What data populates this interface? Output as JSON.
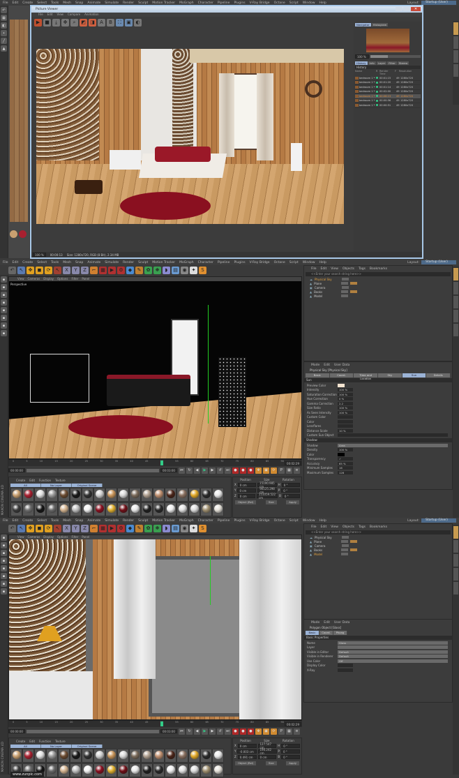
{
  "menu": [
    "File",
    "Edit",
    "Create",
    "Select",
    "Tools",
    "Mesh",
    "Snap",
    "Animate",
    "Simulate",
    "Render",
    "Sculpt",
    "Motion Tracker",
    "MoGraph",
    "Character",
    "Pipeline",
    "Plugins",
    "V-Ray Bridge",
    "Octane",
    "Script",
    "Window",
    "Help"
  ],
  "layout_label": "Layout:",
  "layout_value": "Startup (User)",
  "picture_viewer": {
    "title": "Picture Viewer",
    "menu": [
      "File",
      "Edit",
      "View",
      "Compare",
      "Animation"
    ],
    "side_tabs": [
      "Navigator",
      "Histogram"
    ],
    "zoom": "100 %",
    "info_tabs": [
      "History",
      "Info",
      "Layer",
      "Filter",
      "Stereo"
    ],
    "history_label": "History",
    "columns": [
      "Name",
      "R",
      "Render Time",
      "F",
      "Resolution"
    ],
    "rows": [
      {
        "name": "bedroom 1 *",
        "time": "00:01:15",
        "frame": "49",
        "res": "1280x720"
      },
      {
        "name": "bedroom 1 *",
        "time": "00:01:20",
        "frame": "49",
        "res": "1280x720"
      },
      {
        "name": "bedroom 1 *",
        "time": "00:01:14",
        "frame": "49",
        "res": "1280x720"
      },
      {
        "name": "bedroom 1 *",
        "time": "00:02:00",
        "frame": "49",
        "res": "1280x720"
      },
      {
        "name": "bedroom 1 *",
        "time": "00:06:13",
        "frame": "49",
        "res": "1280x720",
        "selected": true
      },
      {
        "name": "bedroom 1 *",
        "time": "00:00:56",
        "frame": "49",
        "res": "1280x720"
      },
      {
        "name": "bedroom 1 *",
        "time": "00:00:51",
        "frame": "49",
        "res": "1280x720"
      }
    ],
    "status_zoom": "100 %",
    "status_time": "00:00:13",
    "status_size": "Size: 1280x720, RGB (8 Bit), 2.34 MB"
  },
  "panels": [
    {
      "viewport_menu": [
        "View",
        "Cameras",
        "Display",
        "Options",
        "Filter",
        "Panel"
      ],
      "viewport_label": "Perspective",
      "ticks": [
        "0",
        "5",
        "10",
        "15",
        "20",
        "25",
        "30",
        "35",
        "40",
        "45",
        "50",
        "55",
        "60",
        "65",
        "70",
        "75",
        "80",
        "85",
        "90"
      ],
      "frame_end": "00:02:29",
      "time_start": "00:00:00",
      "time_cur": "00:03:00",
      "mat_menu": [
        "Create",
        "Edit",
        "Function",
        "Texture"
      ],
      "mat_tabs": [
        "All",
        "No Layer",
        "Original Scene Textures"
      ],
      "coord_headers": [
        "Position",
        "Size",
        "Rotation"
      ],
      "coords": [
        [
          "X",
          "0 cm",
          "15190.985 cm",
          "H",
          "0 °"
        ],
        [
          "Y",
          "0 cm",
          "90125.298 cm",
          "P",
          "0 °"
        ],
        [
          "Z",
          "0 cm",
          "151059.522 cm",
          "B",
          "0 °"
        ]
      ],
      "coord_mode": "Object (Rel)",
      "coord_size": "Size",
      "apply": "Apply",
      "om_menu": [
        "File",
        "Edit",
        "View",
        "Objects",
        "Tags",
        "Bookmarks"
      ],
      "search_placeholder": "<<Enter your search string here>>",
      "objects": [
        "Physical Sky",
        "Plane",
        "Camera",
        "Books",
        "Model"
      ],
      "am_menu": [
        "Mode",
        "Edit",
        "User Data"
      ],
      "am_title": "Physical Sky [Physical Sky]",
      "am_tabs": [
        "Basic",
        "Coord.",
        "Time and Location",
        "Sky",
        "Sun",
        "Details"
      ],
      "am_active": 4,
      "section": "Sun",
      "props": [
        {
          "label": "Preview Color",
          "value": ""
        },
        {
          "label": "Intensity",
          "value": "100 %"
        },
        {
          "label": "Saturation Correction",
          "value": "100 %"
        },
        {
          "label": "Hue Correction",
          "value": "0 %"
        },
        {
          "label": "Gamma Correction",
          "value": "2.2"
        },
        {
          "label": "Size Ratio",
          "value": "100 %"
        },
        {
          "label": "As Seen Intensity",
          "value": "100 %"
        },
        {
          "label": "Custom Color",
          "value": ""
        },
        {
          "label": "Color",
          "value": ""
        },
        {
          "label": "Lensflares",
          "value": ""
        },
        {
          "label": "Distance Scale",
          "value": "10 %"
        },
        {
          "label": "Custom Sun Object",
          "value": ""
        }
      ],
      "section2": "Shadow",
      "props2": [
        {
          "label": "Shadow",
          "wide": "Area"
        },
        {
          "label": "Density",
          "value": "100 %"
        },
        {
          "label": "Color",
          "value": ""
        },
        {
          "label": "Transparency",
          "value": "✓"
        },
        {
          "label": "Accuracy",
          "value": "65 %"
        },
        {
          "label": "Minimum Samples",
          "value": "16"
        },
        {
          "label": "Maximum Samples",
          "value": "128"
        }
      ]
    },
    {
      "viewport_menu": [
        "View",
        "Cameras",
        "Display",
        "Options",
        "Filter",
        "Panel"
      ],
      "viewport_label": "",
      "ticks": [
        "0",
        "5",
        "10",
        "15",
        "20",
        "25",
        "30",
        "35",
        "40",
        "45",
        "50",
        "55",
        "60",
        "65",
        "70",
        "75",
        "80",
        "85",
        "90"
      ],
      "frame_end": "00:02:29",
      "time_start": "00:00:00",
      "time_cur": "00:03:00",
      "mat_menu": [
        "Create",
        "Edit",
        "Function",
        "Texture"
      ],
      "mat_tabs": [
        "All",
        "No Layer",
        "Original Scene Textures"
      ],
      "coord_headers": [
        "Position",
        "Size",
        "Rotation"
      ],
      "coords": [
        [
          "X",
          "0 cm",
          "127.547 cm",
          "H",
          "0 °"
        ],
        [
          "Y",
          "-0.003 cm",
          "190.242 cm",
          "P",
          "0 °"
        ],
        [
          "Z",
          "0.491 cm",
          "0 cm",
          "B",
          "0 °"
        ]
      ],
      "coord_mode": "Object (Rel)",
      "coord_size": "Size",
      "apply": "Apply",
      "om_menu": [
        "File",
        "Edit",
        "View",
        "Objects",
        "Tags",
        "Bookmarks"
      ],
      "search_placeholder": "<<Enter your search string here>>",
      "objects": [
        "Physical Sky",
        "Plane",
        "Camera",
        "Books",
        "Model"
      ],
      "am_menu": [
        "Mode",
        "Edit",
        "User Data"
      ],
      "am_title": "Polygon Object [Glass]",
      "am_tabs": [
        "Basic",
        "Coord.",
        "Phong"
      ],
      "am_active": 0,
      "section": "Basic Properties",
      "props": [
        {
          "label": "Name",
          "wide": "Glass"
        },
        {
          "label": "Layer",
          "wide": ""
        },
        {
          "label": "Visible in Editor",
          "wide": "Default"
        },
        {
          "label": "Visible in Renderer",
          "wide": "Default"
        },
        {
          "label": "Use Color",
          "wide": "Off"
        },
        {
          "label": "Display Color",
          "value": ""
        },
        {
          "label": "X-Ray",
          "value": ""
        }
      ],
      "section2": "",
      "props2": []
    }
  ],
  "materials": [
    "#c9a070",
    "#a82030",
    "#e0e0e0",
    "#9a9a9a",
    "#6a4a30",
    "#181818",
    "#303030",
    "#cfcfcf",
    "#c8955a",
    "#d8d8d8",
    "#7a6a5a",
    "#b0a090",
    "#c09070",
    "#4a2418",
    "#8a7060",
    "#e0a828",
    "#2a2a2a",
    "#e8e8e8",
    "#3a3a3a",
    "#707070",
    "#151515",
    "#6a6a6a",
    "#d4b490",
    "#c0c0c0",
    "#f0f0f0",
    "#8a1020",
    "#e0b030",
    "#701018",
    "#e8e8e8",
    "#202020",
    "#282828",
    "#ededed",
    "#e0e0e0",
    "#dcdcdc",
    "#a09070",
    "#e4e0d8"
  ],
  "watermark": "www.zunpic.com",
  "brand": "MAXON CINEMA 4D"
}
